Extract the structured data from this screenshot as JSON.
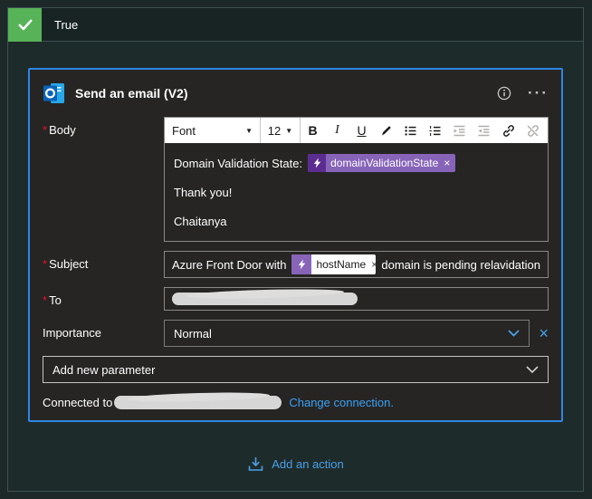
{
  "glyphs": {
    "dropdown_arrow": "▼",
    "close": "×",
    "ellipsis_menu": "···",
    "required_marker": "*"
  },
  "colors": {
    "page_background": "#1d2929",
    "card_border_blue": "#2f86e3",
    "success_green": "#57b357",
    "token_purple": "#8764b8",
    "token_icon_purple": "#5c2d91",
    "link_blue": "#3aa0f3",
    "chevron_blue": "#4ba0e8",
    "required_red": "#e81123"
  },
  "branch": {
    "label": "True"
  },
  "card": {
    "title": "Send an email (V2)",
    "body": {
      "label": "Body",
      "toolbar": {
        "font": "Font",
        "size": "12",
        "bold": "B",
        "italic": "I",
        "underline": "U"
      },
      "line1_prefix": "Domain Validation State:",
      "token": "domainValidationState",
      "line2": "Thank you!",
      "line3": "Chaitanya"
    },
    "subject": {
      "label": "Subject",
      "prefix": "Azure Front Door with",
      "token": "hostName",
      "suffix": "domain is pending relavidation"
    },
    "to": {
      "label": "To"
    },
    "importance": {
      "label": "Importance",
      "value": "Normal"
    },
    "add_parameter_label": "Add new parameter",
    "connection": {
      "prefix": "Connected to",
      "link": "Change connection."
    }
  },
  "footer": {
    "add_action": "Add an action"
  },
  "icons": [
    "check-icon",
    "outlook-icon",
    "info-icon",
    "ellipsis-menu",
    "dropdown-arrow-icon",
    "text-color-icon",
    "bullet-list-icon",
    "numbered-list-icon",
    "outdent-icon",
    "indent-icon",
    "link-icon",
    "unlink-icon",
    "expression-icon",
    "close-icon",
    "chevron-down-icon",
    "add-action-icon"
  ]
}
